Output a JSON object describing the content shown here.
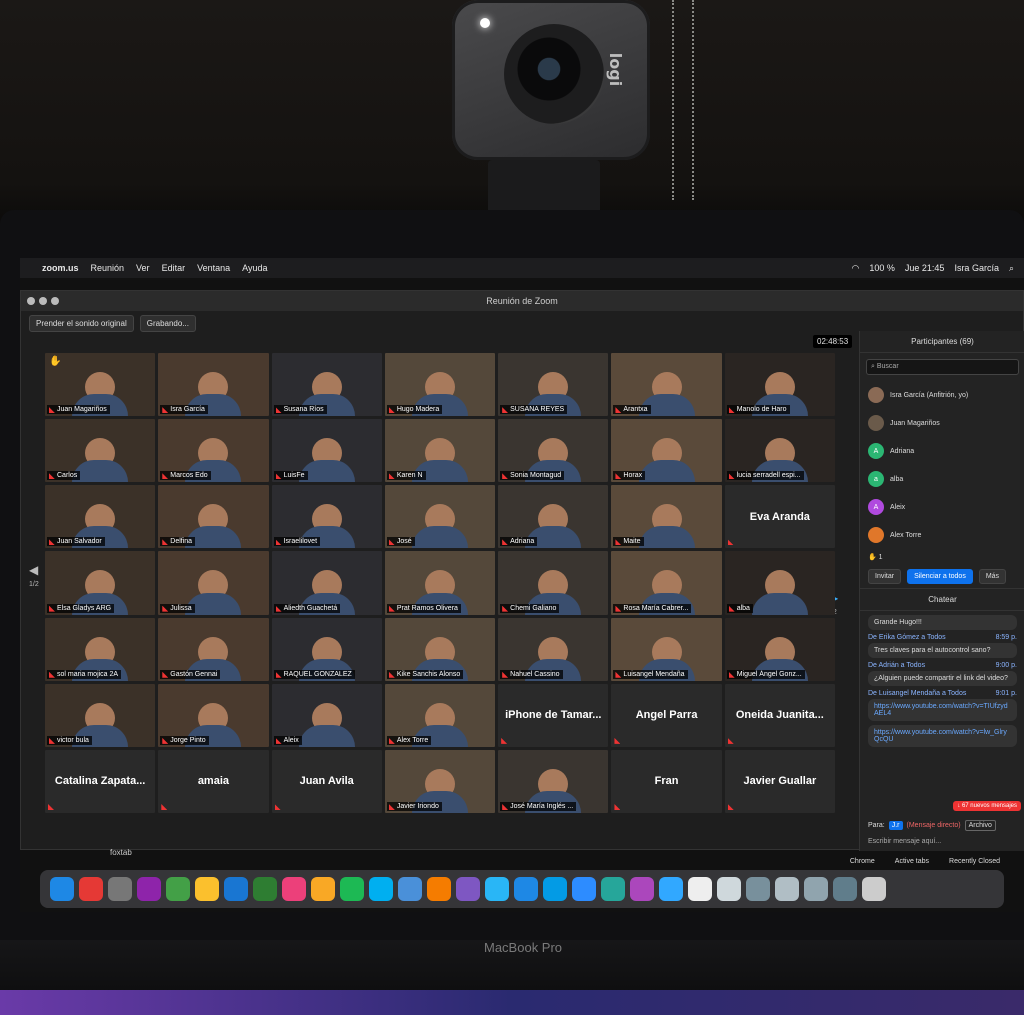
{
  "menubar": {
    "app": "zoom.us",
    "items": [
      "Reunión",
      "Ver",
      "Editar",
      "Ventana",
      "Ayuda"
    ],
    "battery": "100 %",
    "clock": "Jue 21:45",
    "user": "Isra García"
  },
  "window": {
    "title": "Reunión de Zoom",
    "toolbar_sound": "Prender el sonido original",
    "toolbar_record": "Grabando...",
    "timer": "02:48:53",
    "page_left": "1/2",
    "page_right": "1/2"
  },
  "grid": {
    "tiles": [
      {
        "name": "Juan Magariños",
        "hand": true
      },
      {
        "name": "Isra García"
      },
      {
        "name": "Susana Ríos"
      },
      {
        "name": "Hugo Madera"
      },
      {
        "name": "SUSANA REYES"
      },
      {
        "name": "Arantxa"
      },
      {
        "name": "Manolo de Haro"
      },
      {
        "name": "Carlos"
      },
      {
        "name": "Marcos Edo"
      },
      {
        "name": "LuisFe"
      },
      {
        "name": "Karen N"
      },
      {
        "name": "Sonia Montagud"
      },
      {
        "name": "Horax"
      },
      {
        "name": "lucia serradell espi..."
      },
      {
        "name": "Juan Salvador"
      },
      {
        "name": "Delfina"
      },
      {
        "name": "Israelilovet"
      },
      {
        "name": "José"
      },
      {
        "name": "Adriana"
      },
      {
        "name": "Maite"
      },
      {
        "big": "Eva Aranda"
      },
      {
        "name": "Elsa Gladys ARG"
      },
      {
        "name": "Julissa"
      },
      {
        "name": "Aliedth Guachetá"
      },
      {
        "name": "Prat Ramos Olivera"
      },
      {
        "name": "Chemi Galiano"
      },
      {
        "name": "Rosa María Cabrer..."
      },
      {
        "name": "alba"
      },
      {
        "name": "sol maria mojica 2A"
      },
      {
        "name": "Gastón Gennai"
      },
      {
        "name": "RAQUEL GONZALEZ"
      },
      {
        "name": "Kike Sanchis Alonso"
      },
      {
        "name": "Nahuel Cassino"
      },
      {
        "name": "Luisangel Mendaña"
      },
      {
        "name": "Miguel Ángel Gonz..."
      },
      {
        "name": "victor bula"
      },
      {
        "name": "Jorge Pinto"
      },
      {
        "name": "Aleix"
      },
      {
        "name": "Alex Torre"
      },
      {
        "big": "iPhone de Tamar..."
      },
      {
        "big": "Angel Parra"
      },
      {
        "big": "Oneida Juanita..."
      },
      {
        "big": "Catalina Zapata..."
      },
      {
        "big": "amaia"
      },
      {
        "big": "Juan Avila"
      },
      {
        "name": "Javier Iriondo"
      },
      {
        "name": "José María Inglés ..."
      },
      {
        "big": "Fran"
      },
      {
        "big": "Javier Guallar"
      }
    ]
  },
  "participants": {
    "header": "Participantes (69)",
    "search_placeholder": "Buscar",
    "list": [
      {
        "name": "Isra García (Anfitrión, yo)",
        "initial": "",
        "color": "#8a6a55"
      },
      {
        "name": "Juan Magariños",
        "initial": "",
        "color": "#6a5a4a"
      },
      {
        "name": "Adriana",
        "initial": "A",
        "color": "#2bb673"
      },
      {
        "name": "alba",
        "initial": "a",
        "color": "#2bb673"
      },
      {
        "name": "Aleix",
        "initial": "A",
        "color": "#b04adf"
      },
      {
        "name": "Alex Torre",
        "initial": "",
        "color": "#e0772a"
      }
    ],
    "count": "1",
    "invite": "Invitar",
    "mute_all": "Silenciar a todos",
    "more": "Más"
  },
  "chat": {
    "header": "Chatear",
    "messages": [
      {
        "from": "",
        "time": "",
        "text": "Grande Hugo!!!"
      },
      {
        "from": "De Erika Gómez a Todos",
        "time": "8:59 p.",
        "text": "Tres claves para el autocontrol sano?"
      },
      {
        "from": "De Adrián a Todos",
        "time": "9:00 p.",
        "text": "¿Alguien puede compartir el link del video?"
      },
      {
        "from": "De Luisangel Mendaña a Todos",
        "time": "9:01 p.",
        "text": "https://www.youtube.com/watch?v=TIUfzydAEL4"
      },
      {
        "from": "",
        "time": "",
        "text": "https://www.youtube.com/watch?v=lw_GlryQcQU"
      }
    ],
    "new_messages": "↓ 67 nuevos mensajes",
    "to_label": "Para:",
    "to_value": "J.r",
    "direct": "(Mensaje directo)",
    "file": "Archivo",
    "placeholder": "Escribir mensaje aquí..."
  },
  "dock": {
    "tab_label": "foxtab",
    "right_labels": [
      "Chrome",
      "Active tabs",
      "Recently Closed"
    ]
  },
  "laptop": {
    "model": "MacBook Pro"
  },
  "webcam": {
    "brand": "logi"
  }
}
